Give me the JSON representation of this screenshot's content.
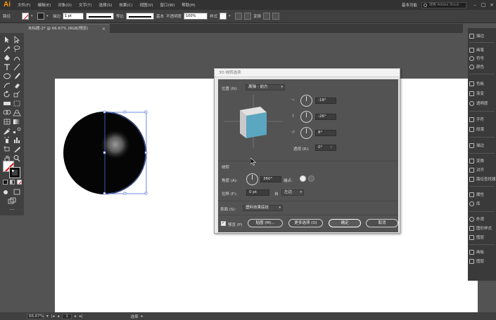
{
  "app": {
    "logo": "Ai",
    "menus": [
      "文件(F)",
      "编辑(E)",
      "对象(O)",
      "文字(T)",
      "选择(S)",
      "效果(C)",
      "视图(V)",
      "窗口(W)",
      "帮助(H)"
    ],
    "workspace": "基本功能",
    "search_placeholder": "搜索 Adobe Stock"
  },
  "control_bar": {
    "selection_label": "路径",
    "stroke_label": "描边",
    "stroke_weight": "1 pt",
    "brush_label": "等比",
    "profile_label": "基本",
    "opacity_label": "不透明度",
    "opacity_value": "100%",
    "style_label": "样式",
    "transform_label": "变换"
  },
  "document": {
    "tab_title": "未标题-2* @ 66.67% (RGB/预览)",
    "zoom": "66.67%",
    "page": "1",
    "status_tool": "选择"
  },
  "panels": {
    "items": [
      "描边",
      "画笔",
      "符号",
      "颜色",
      "色板",
      "渐变",
      "透明度",
      "字符",
      "段落",
      "描边",
      "变换",
      "对齐",
      "路径查找器",
      "属性",
      "库",
      "外观",
      "图形样式",
      "图层",
      "画板",
      "图层"
    ]
  },
  "dialog": {
    "title": "3D 绕转选项",
    "position_label": "位置 (N):",
    "position_value": "离轴 - 前方",
    "rot_x": "-18°",
    "rot_y": "-26°",
    "rot_z": "8°",
    "perspective_label": "透视 (R):",
    "perspective_value": "0°",
    "revolve_section": "绕转",
    "angle_label": "角度 (A):",
    "angle_value": "360°",
    "cap_label": "端点:",
    "offset_label": "位移 (F):",
    "offset_value": "0 pt",
    "from_label": "自",
    "from_value": "左边",
    "surface_label": "表面 (S):",
    "surface_value": "塑料效果底纹",
    "preview_label": "预览 (P)",
    "btn_map": "贴图 (M)...",
    "btn_more": "更多选项 (O)",
    "btn_ok": "确定",
    "btn_cancel": "取消"
  },
  "colors": {
    "cube_front": "#5ba6c0",
    "cube_side": "#c9c9c9",
    "cube_top": "#e2e2e2",
    "selection": "#4a6bd8",
    "logo": "#ff9a00"
  }
}
